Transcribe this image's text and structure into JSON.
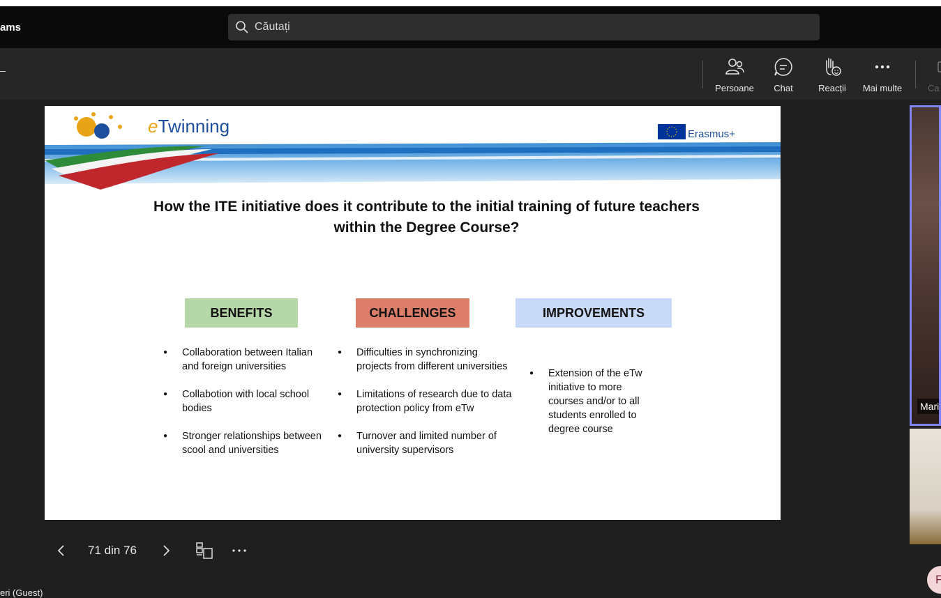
{
  "app": {
    "title_fragment": "ams"
  },
  "search": {
    "placeholder": "Căutați"
  },
  "toolbar": {
    "people_label": "Persoane",
    "chat_label": "Chat",
    "reactions_label": "Reacții",
    "more_label": "Mai multe",
    "camera_label": "Ca"
  },
  "slide": {
    "logo_text_e": "e",
    "logo_text_rest": "Twinning",
    "erasmus_text": "Erasmus+",
    "question": "How the ITE initiative does it contribute to the initial training of future teachers within the Degree Course?",
    "columns": [
      {
        "header": "BENEFITS",
        "color": "#b6d7a8",
        "items": [
          "Collaboration between Italian and foreign universities",
          "Collabotion with local school bodies",
          "Stronger relationships between scool and universities"
        ]
      },
      {
        "header": "CHALLENGES",
        "color": "#dd7e6b",
        "items": [
          "Difficulties in synchronizing projects from different universities",
          "Limitations of research due to data protection policy from eTw",
          "Turnover and limited number of university supervisors"
        ]
      },
      {
        "header": "IMPROVEMENTS",
        "color": "#c9daf8",
        "items": [
          "Extension of the eTw initiative to more courses and/or to all students enrolled to degree course"
        ]
      }
    ]
  },
  "controls": {
    "page_indicator": "71 din 76"
  },
  "participants": {
    "tile1_name": "Mari",
    "guest_label": "eri (Guest)",
    "avatar_initial": "F"
  },
  "colors": {
    "accent_border": "#7f85f5",
    "avatar_bg": "#f3d6d8"
  }
}
